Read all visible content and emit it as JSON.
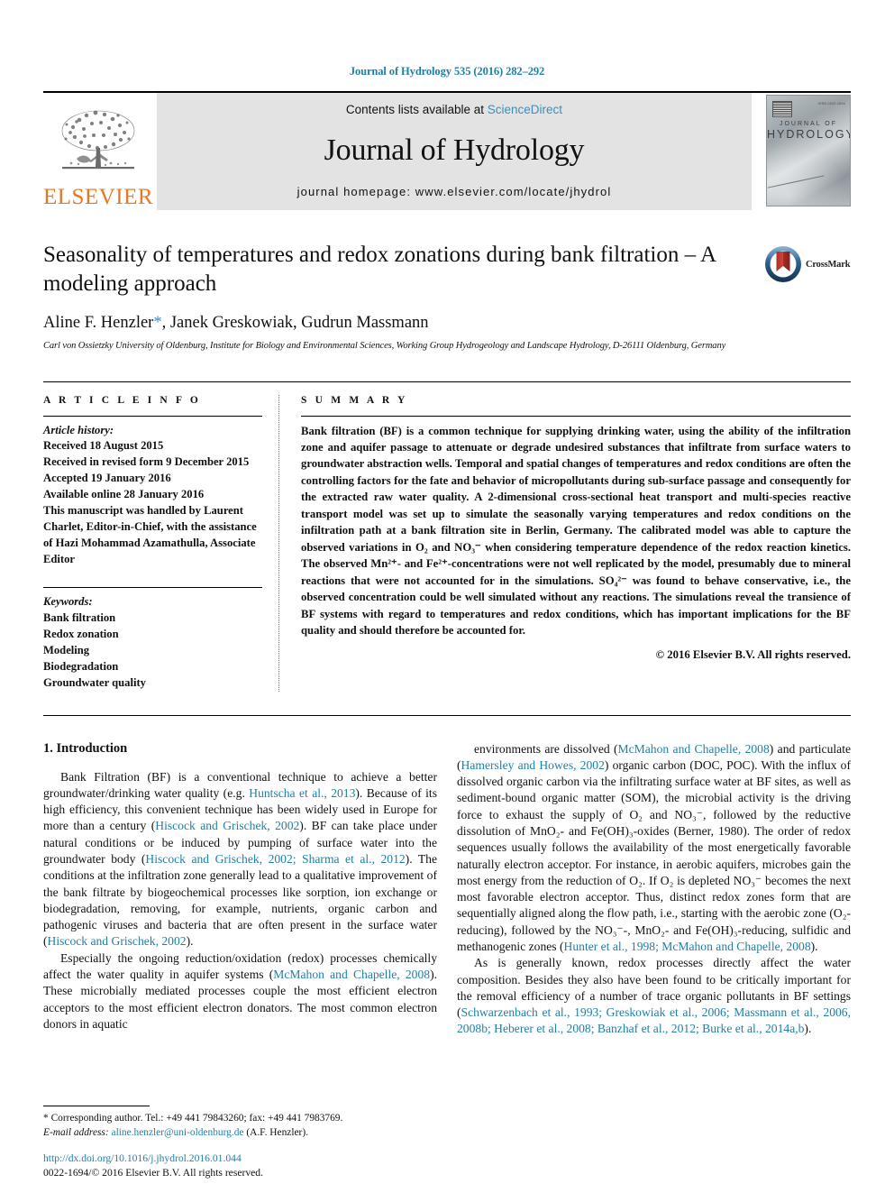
{
  "running_head": "Journal of Hydrology 535 (2016) 282–292",
  "masthead": {
    "publisher_logo_label": "ELSEVIER",
    "contents_prefix": "Contents lists available at",
    "contents_link": "ScienceDirect",
    "journal_title": "Journal of Hydrology",
    "homepage_label": "journal homepage: www.elsevier.com/locate/jhydrol",
    "cover_line1": "JOURNAL OF",
    "cover_line2": "HYDROLOGY",
    "cover_issn": "ISSN 0022-1694"
  },
  "article": {
    "title": "Seasonality of temperatures and redox zonations during bank filtration – A modeling approach",
    "authors": "Aline F. Henzler",
    "corresponding_marker": "*",
    "authors_rest": ", Janek Greskowiak, Gudrun Massmann",
    "affiliation": "Carl von Ossietzky University of Oldenburg, Institute for Biology and Environmental Sciences, Working Group Hydrogeology and Landscape Hydrology, D-26111 Oldenburg, Germany",
    "crossmark_label": "CrossMark"
  },
  "info": {
    "heading": "A R T I C L E   I N F O",
    "history_label": "Article history:",
    "history": [
      "Received 18 August 2015",
      "Received in revised form 9 December 2015",
      "Accepted 19 January 2016",
      "Available online 28 January 2016",
      "This manuscript was handled by Laurent",
      "Charlet, Editor-in-Chief, with the assistance",
      "of Hazi Mohammad Azamathulla, Associate",
      "Editor"
    ],
    "keywords_label": "Keywords:",
    "keywords": [
      "Bank filtration",
      "Redox zonation",
      "Modeling",
      "Biodegradation",
      "Groundwater quality"
    ]
  },
  "summary": {
    "heading": "S U M M A R Y",
    "text": "Bank filtration (BF) is a common technique for supplying drinking water, using the ability of the infiltration zone and aquifer passage to attenuate or degrade undesired substances that infiltrate from surface waters to groundwater abstraction wells. Temporal and spatial changes of temperatures and redox conditions are often the controlling factors for the fate and behavior of micropollutants during sub-surface passage and consequently for the extracted raw water quality. A 2-dimensional cross-sectional heat transport and multi-species reactive transport model was set up to simulate the seasonally varying temperatures and redox conditions on the infiltration path at a bank filtration site in Berlin, Germany. The calibrated model was able to capture the observed variations in O₂ and NO₃⁻ when considering temperature dependence of the redox reaction kinetics. The observed Mn²⁺- and Fe²⁺-concentrations were not well replicated by the model, presumably due to mineral reactions that were not accounted for in the simulations. SO₄²⁻ was found to behave conservative, i.e., the observed concentration could be well simulated without any reactions. The simulations reveal the transience of BF systems with regard to temperatures and redox conditions, which has important implications for the BF quality and should therefore be accounted for.",
    "copyright": "© 2016 Elsevier B.V. All rights reserved."
  },
  "body": {
    "section_number_title": "1. Introduction",
    "left_paragraphs": [
      "Bank Filtration (BF) is a conventional technique to achieve a better groundwater/drinking water quality (e.g. Huntscha et al., 2013). Because of its high efficiency, this convenient technique has been widely used in Europe for more than a century (Hiscock and Grischek, 2002). BF can take place under natural conditions or be induced by pumping of surface water into the groundwater body (Hiscock and Grischek, 2002; Sharma et al., 2012). The conditions at the infiltration zone generally lead to a qualitative improvement of the bank filtrate by biogeochemical processes like sorption, ion exchange or biodegradation, removing, for example, nutrients, organic carbon and pathogenic viruses and bacteria that are often present in the surface water (Hiscock and Grischek, 2002).",
      "Especially the ongoing reduction/oxidation (redox) processes chemically affect the water quality in aquifer systems (McMahon and Chapelle, 2008). These microbially mediated processes couple the most efficient electron acceptors to the most efficient electron donators. The most common electron donors in aquatic"
    ],
    "right_paragraphs": [
      "environments are dissolved (McMahon and Chapelle, 2008) and particulate (Hamersley and Howes, 2002) organic carbon (DOC, POC). With the influx of dissolved organic carbon via the infiltrating surface water at BF sites, as well as sediment-bound organic matter (SOM), the microbial activity is the driving force to exhaust the supply of O₂ and NO₃⁻, followed by the reductive dissolution of MnO₂- and Fe(OH)₃-oxides (Berner, 1980). The order of redox sequences usually follows the availability of the most energetically favorable naturally electron acceptor. For instance, in aerobic aquifers, microbes gain the most energy from the reduction of O₂. If O₂ is depleted NO₃⁻ becomes the next most favorable electron acceptor. Thus, distinct redox zones form that are sequentially aligned along the flow path, i.e., starting with the aerobic zone (O₂-reducing), followed by the NO₃⁻-, MnO₂- and Fe(OH)₃-reducing, sulfidic and methanogenic zones (Hunter et al., 1998; McMahon and Chapelle, 2008).",
      "As is generally known, redox processes directly affect the water composition. Besides they also have been found to be critically important for the removal efficiency of a number of trace organic pollutants in BF settings (Schwarzenbach et al., 1993; Greskowiak et al., 2006; Massmann et al., 2006, 2008b; Heberer et al., 2008; Banzhaf et al., 2012; Burke et al., 2014a,b)."
    ]
  },
  "footnote": {
    "marker": "*",
    "corresponding": "Corresponding author. Tel.: +49 441 79843260; fax: +49 441 7983769.",
    "email_label": "E-mail address:",
    "email": "aline.henzler@uni-oldenburg.de",
    "email_suffix": "(A.F. Henzler)."
  },
  "doi": {
    "url": "http://dx.doi.org/10.1016/j.jhydrol.2016.01.044",
    "issn_line": "0022-1694/© 2016 Elsevier B.V. All rights reserved."
  },
  "colors": {
    "link": "#1f7fa8",
    "elsevier_orange": "#E87722",
    "banner_gray": "#e3e3e3"
  }
}
